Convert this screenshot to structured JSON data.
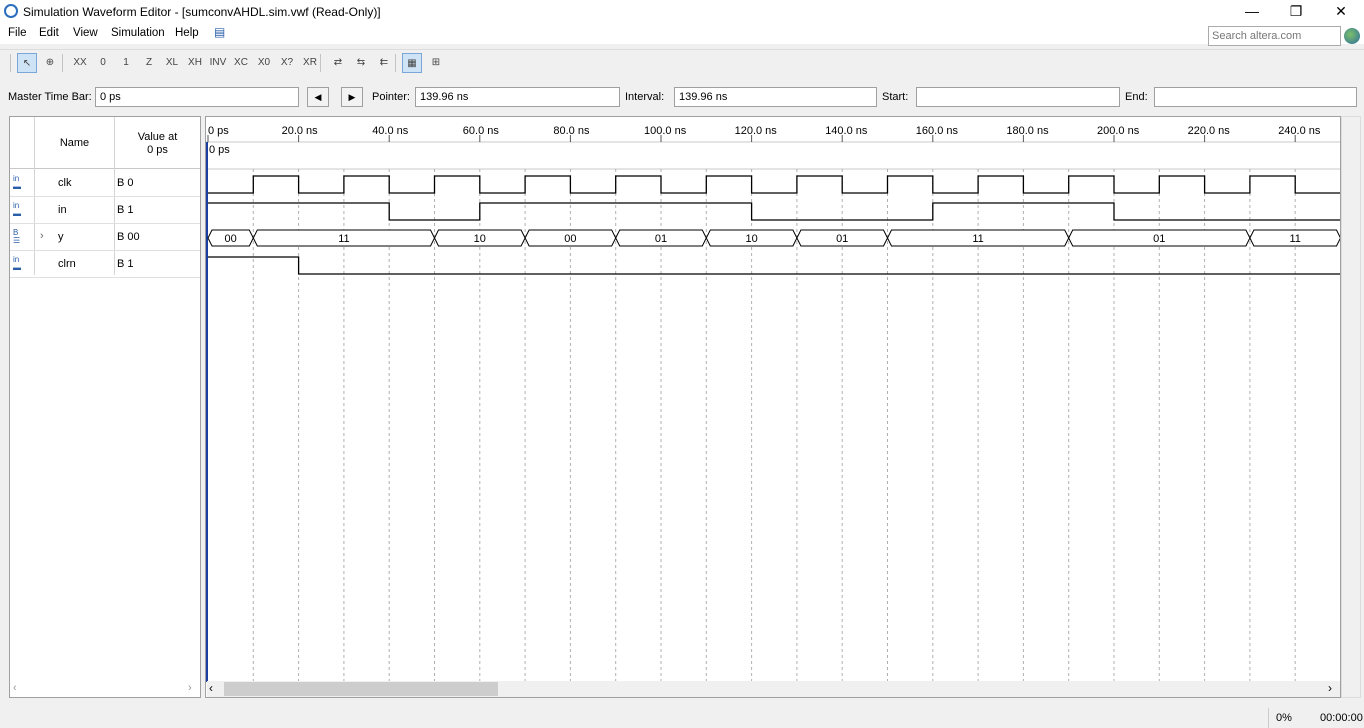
{
  "window": {
    "title": "Simulation Waveform Editor - [sumconvAHDL.sim.vwf (Read-Only)]",
    "minimize": "—",
    "restore": "❐",
    "close": "✕"
  },
  "menu": [
    "File",
    "Edit",
    "View",
    "Simulation",
    "Help"
  ],
  "search": {
    "placeholder": "Search altera.com"
  },
  "toolbar": {
    "icons": [
      "pointer-tool-icon",
      "zoom-tool-icon",
      "forcing-unknown-icon",
      "forcing-low-icon",
      "forcing-high-icon",
      "high-impedance-icon",
      "weak-low-icon",
      "weak-high-icon",
      "invert-icon",
      "count-value-icon",
      "clock-value-icon",
      "random-value-icon",
      "arbitrary-value-icon",
      "snap-to-grid-icon",
      "group-icon",
      "ungroup-icon",
      "grid-icon",
      "expand-icon"
    ],
    "glyphs": [
      "↖",
      "⊕",
      "XX",
      "0",
      "1",
      "Z",
      "XL",
      "XH",
      "INV",
      "XC",
      "X0",
      "X?",
      "XR",
      "⇄",
      "⇆",
      "⇇",
      "▦",
      "⊞"
    ]
  },
  "controls": {
    "master_time_bar_label": "Master Time Bar:",
    "master_time_bar_value": "0 ps",
    "pointer_label": "Pointer:",
    "pointer_value": "139.96 ns",
    "interval_label": "Interval:",
    "interval_value": "139.96 ns",
    "start_label": "Start:",
    "start_value": "",
    "end_label": "End:",
    "end_value": "",
    "prev_glyph": "◀",
    "next_glyph": "▶"
  },
  "table_header": {
    "name": "Name",
    "value_line1": "Value at",
    "value_line2": "0 ps"
  },
  "signals": [
    {
      "name": "clk",
      "value": "B 0",
      "icon": "input-pin-icon",
      "icon_text": "in"
    },
    {
      "name": "in",
      "value": "B 1",
      "icon": "input-pin-icon",
      "icon_text": "in"
    },
    {
      "name": "y",
      "value": "B 00",
      "icon": "bus-output-icon",
      "icon_text": "B",
      "expandable": true
    },
    {
      "name": "clrn",
      "value": "B 1",
      "icon": "input-pin-icon",
      "icon_text": "in"
    }
  ],
  "timeline": {
    "ticks": [
      "0 ps",
      "20.0 ns",
      "40.0 ns",
      "60.0 ns",
      "80.0 ns",
      "100.0 ns",
      "120.0 ns",
      "140.0 ns",
      "160.0 ns",
      "180.0 ns",
      "200.0 ns",
      "220.0 ns",
      "240.0 ns"
    ],
    "master_marker_label": "0 ps"
  },
  "waveforms": {
    "clk": {
      "period_ns": 20,
      "high_intervals_ns": [
        [
          10,
          20
        ],
        [
          30,
          40
        ],
        [
          50,
          60
        ],
        [
          70,
          80
        ],
        [
          90,
          100
        ],
        [
          110,
          120
        ],
        [
          130,
          140
        ],
        [
          150,
          160
        ],
        [
          170,
          180
        ],
        [
          190,
          200
        ],
        [
          210,
          220
        ],
        [
          230,
          240
        ]
      ]
    },
    "in": {
      "transitions_ns": [
        [
          0,
          1
        ],
        [
          40,
          0
        ],
        [
          60,
          1
        ],
        [
          120,
          0
        ],
        [
          160,
          1
        ],
        [
          200,
          0
        ]
      ]
    },
    "y": {
      "segments": [
        {
          "from": 0,
          "to": 10,
          "value": "00"
        },
        {
          "from": 10,
          "to": 50,
          "value": "11"
        },
        {
          "from": 50,
          "to": 70,
          "value": "10"
        },
        {
          "from": 70,
          "to": 90,
          "value": "00"
        },
        {
          "from": 90,
          "to": 110,
          "value": "01"
        },
        {
          "from": 110,
          "to": 130,
          "value": "10"
        },
        {
          "from": 130,
          "to": 150,
          "value": "01"
        },
        {
          "from": 150,
          "to": 190,
          "value": "11"
        },
        {
          "from": 190,
          "to": 230,
          "value": "01"
        },
        {
          "from": 230,
          "to": 250,
          "value": "11"
        }
      ]
    },
    "clrn": {
      "transitions_ns": [
        [
          0,
          1
        ],
        [
          20,
          0
        ]
      ]
    }
  },
  "status": {
    "progress": "0%",
    "elapsed": "00:00:00"
  }
}
